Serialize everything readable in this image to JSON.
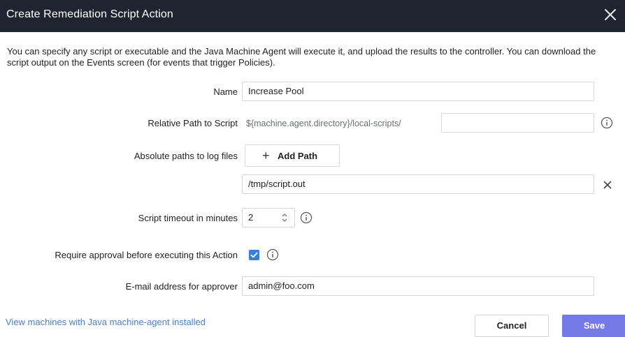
{
  "dialog": {
    "title": "Create Remediation Script Action",
    "description": "You can specify any script or executable and the Java Machine Agent will execute it, and upload the results to the controller. You can download the script output on the Events screen (for events that trigger Policies)."
  },
  "form": {
    "name": {
      "label": "Name",
      "value": "Increase Pool"
    },
    "relative_path": {
      "label": "Relative Path to Script",
      "prefix": "${machine.agent.directory}/local-scripts/",
      "value": ""
    },
    "log_files": {
      "label": "Absolute paths to log files",
      "add_label": "Add Path",
      "paths": [
        "/tmp/script.out"
      ]
    },
    "timeout": {
      "label": "Script timeout in minutes",
      "value": "2"
    },
    "approval": {
      "label": "Require approval before executing this Action",
      "checked": true
    },
    "approver_email": {
      "label": "E-mail address for approver",
      "value": "admin@foo.com"
    }
  },
  "footer": {
    "link": "View machines with Java machine-agent installed",
    "cancel_label": "Cancel",
    "save_label": "Save"
  },
  "colors": {
    "titlebar": "#1f2530",
    "primary": "#7579e8",
    "link": "#4a7fc8",
    "checkbox": "#3a7fd6"
  }
}
